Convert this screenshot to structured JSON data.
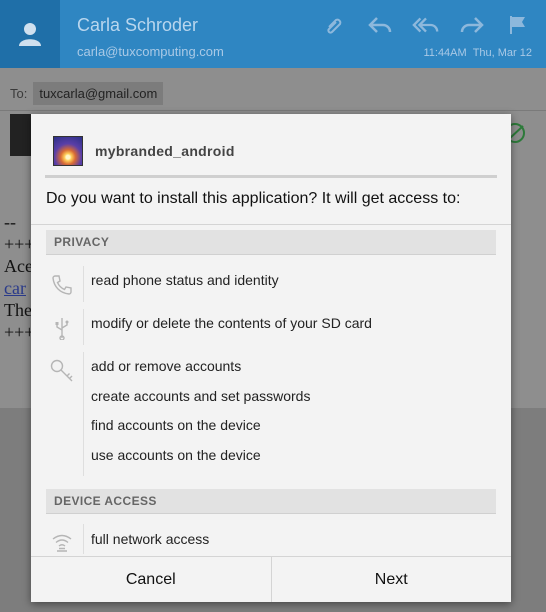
{
  "email": {
    "sender_name": "Carla Schroder",
    "sender_email": "carla@tuxcomputing.com",
    "time": "11:44AM",
    "date": "Thu, Mar 12",
    "to_label": "To:",
    "to_address": "tuxcarla@gmail.com",
    "body_lines": [
      "--",
      "+++",
      "Ace",
      "car",
      "The",
      "+++"
    ]
  },
  "dialog": {
    "app_name": "mybranded_android",
    "question": "Do you want to install this application? It will get access to:",
    "sections": {
      "privacy": {
        "title": "PRIVACY",
        "items": [
          "read phone status and identity",
          "modify or delete the contents of your SD card",
          "add or remove accounts",
          "create accounts and set passwords",
          "find accounts on the device",
          "use accounts on the device"
        ]
      },
      "device_access": {
        "title": "DEVICE ACCESS",
        "items": [
          "full network access"
        ]
      }
    },
    "buttons": {
      "cancel": "Cancel",
      "next": "Next"
    }
  },
  "icons": {
    "header": [
      "attach-icon",
      "reply-icon",
      "reply-all-icon",
      "forward-icon",
      "flag-icon"
    ],
    "permissions": [
      "phone-icon",
      "usb-icon",
      "key-icon",
      "wifi-icon"
    ]
  },
  "colors": {
    "header_blue": "#2f86c2",
    "dialog_bg": "#f3f3f3",
    "section_bg": "#e2e2e2"
  }
}
